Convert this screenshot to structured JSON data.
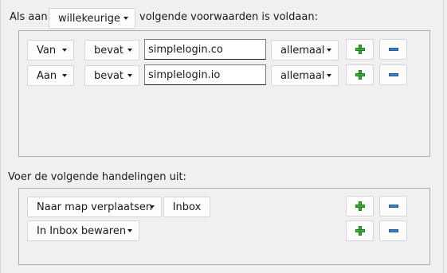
{
  "header": {
    "prefix": "Als aan",
    "match_mode": "willekeurige",
    "suffix": "volgende voorwaarden is voldaan:"
  },
  "conditions": [
    {
      "field": "Van",
      "operator": "bevat",
      "value": "simplelogin.co",
      "case": "allemaal"
    },
    {
      "field": "Aan",
      "operator": "bevat",
      "value": "simplelogin.io",
      "case": "allemaal"
    }
  ],
  "actions_header": "Voer de volgende handelingen uit:",
  "actions": [
    {
      "action": "Naar map verplaatsen",
      "target": "Inbox"
    },
    {
      "action": "In Inbox bewaren"
    }
  ],
  "icons": {
    "add": "plus-icon",
    "remove": "minus-icon"
  },
  "colors": {
    "add_green": "#36b336",
    "remove_blue": "#3e7fd1"
  }
}
